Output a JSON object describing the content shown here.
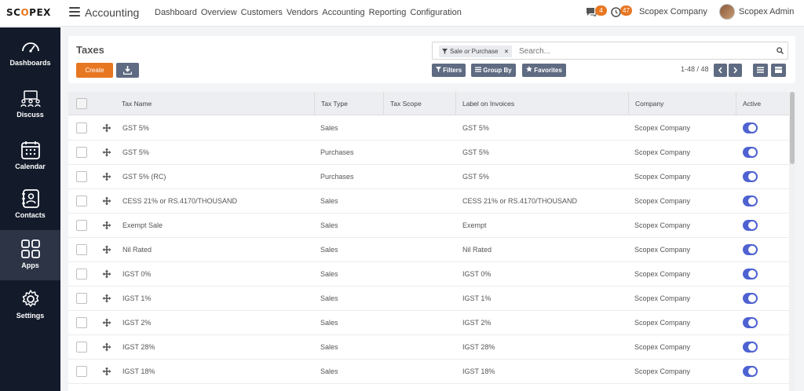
{
  "brand": {
    "logo_prefix": "SC",
    "logo_o": "O",
    "logo_suffix": "PEX",
    "accent": "#e87722"
  },
  "app_name": "Accounting",
  "top_nav": [
    "Dashboard",
    "Overview",
    "Customers",
    "Vendors",
    "Accounting",
    "Reporting",
    "Configuration"
  ],
  "systray": {
    "messages_count": "4",
    "activities_count": "47",
    "company": "Scopex Company",
    "user": "Scopex Admin"
  },
  "sidebar": [
    {
      "label": "Dashboards",
      "icon": "gauge-icon"
    },
    {
      "label": "Discuss",
      "icon": "discuss-icon"
    },
    {
      "label": "Calendar",
      "icon": "calendar-icon"
    },
    {
      "label": "Contacts",
      "icon": "contacts-icon"
    },
    {
      "label": "Apps",
      "icon": "apps-grid-icon",
      "active": true
    },
    {
      "label": "Settings",
      "icon": "gear-icon"
    }
  ],
  "control_panel": {
    "title": "Taxes",
    "create_label": "Create",
    "facet": {
      "part1": "Sale",
      "or": "or",
      "part2": "Purchase"
    },
    "search_placeholder": "Search...",
    "filters_label": "Filters",
    "groupby_label": "Group By",
    "favorites_label": "Favorites",
    "pager": "1-48 / 48"
  },
  "table": {
    "columns": [
      "Tax Name",
      "Tax Type",
      "Tax Scope",
      "Label on Invoices",
      "Company",
      "Active"
    ],
    "rows": [
      {
        "name": "GST 5%",
        "type": "Sales",
        "scope": "",
        "label": "GST 5%",
        "company": "Scopex Company",
        "active": true
      },
      {
        "name": "GST 5%",
        "type": "Purchases",
        "scope": "",
        "label": "GST 5%",
        "company": "Scopex Company",
        "active": true
      },
      {
        "name": "GST 5% (RC)",
        "type": "Purchases",
        "scope": "",
        "label": "GST 5%",
        "company": "Scopex Company",
        "active": true
      },
      {
        "name": "CESS 21% or RS.4170/THOUSAND",
        "type": "Sales",
        "scope": "",
        "label": "CESS 21% or RS.4170/THOUSAND",
        "company": "Scopex Company",
        "active": true
      },
      {
        "name": "Exempt Sale",
        "type": "Sales",
        "scope": "",
        "label": "Exempt",
        "company": "Scopex Company",
        "active": true
      },
      {
        "name": "Nil Rated",
        "type": "Sales",
        "scope": "",
        "label": "Nil Rated",
        "company": "Scopex Company",
        "active": true
      },
      {
        "name": "IGST 0%",
        "type": "Sales",
        "scope": "",
        "label": "IGST 0%",
        "company": "Scopex Company",
        "active": true
      },
      {
        "name": "IGST 1%",
        "type": "Sales",
        "scope": "",
        "label": "IGST 1%",
        "company": "Scopex Company",
        "active": true
      },
      {
        "name": "IGST 2%",
        "type": "Sales",
        "scope": "",
        "label": "IGST 2%",
        "company": "Scopex Company",
        "active": true
      },
      {
        "name": "IGST 28%",
        "type": "Sales",
        "scope": "",
        "label": "IGST 28%",
        "company": "Scopex Company",
        "active": true
      },
      {
        "name": "IGST 18%",
        "type": "Sales",
        "scope": "",
        "label": "IGST 18%",
        "company": "Scopex Company",
        "active": true
      }
    ]
  },
  "colors": {
    "sidebar_bg": "#131b2b",
    "sidebar_active": "#2c3446",
    "toggle_on": "#4e62d1",
    "button_secondary": "#5f6b82"
  }
}
